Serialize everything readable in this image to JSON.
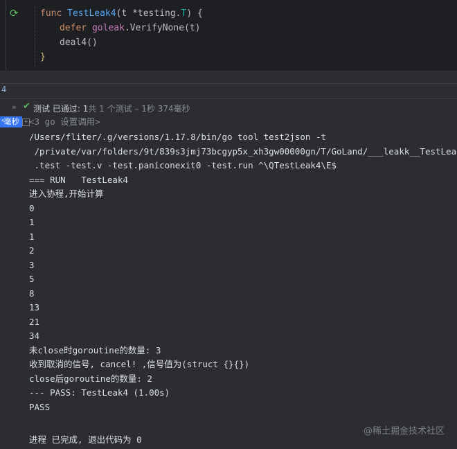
{
  "editor": {
    "line1": {
      "kw": "func",
      "name": "TestLeak4",
      "params": "(t *testing.",
      "type": "T",
      "tail": ") {"
    },
    "line2": {
      "kw": "defer",
      "pkg": "goleak",
      "call": ".VerifyNone(t)"
    },
    "line3": {
      "call": "deal4()"
    },
    "line4": {
      "brace": "}"
    }
  },
  "toolwindow": {
    "tab_number": "4"
  },
  "status": {
    "label": "测试",
    "result": "已通过:",
    "passed_count": "1",
    "rest": "共 1 个测试 – 1秒 374毫秒"
  },
  "test_tree": {
    "time_badge": "毫秒"
  },
  "console": {
    "header": "<3 go 设置调用>",
    "lines": [
      "/Users/fliter/.g/versions/1.17.8/bin/go tool test2json -t",
      " /private/var/folders/9t/839s3jmj73bcgyp5x_xh3gw00000gn/T/GoLand/___leakk__TestLeak4",
      " .test -test.v -test.paniconexit0 -test.run ^\\QTestLeak4\\E$",
      "=== RUN   TestLeak4",
      "进入协程,开始计算",
      "0",
      "1",
      "1",
      "2",
      "3",
      "5",
      "8",
      "13",
      "21",
      "34",
      "未close时goroutine的数量: 3",
      "收到取消的信号, cancel! ,信号值为(struct {}{})",
      "close后goroutine的数量: 2",
      "--- PASS: TestLeak4 (1.00s)",
      "PASS",
      "",
      "进程 已完成, 退出代码为 0"
    ]
  },
  "watermark": "@稀土掘金技术社区"
}
